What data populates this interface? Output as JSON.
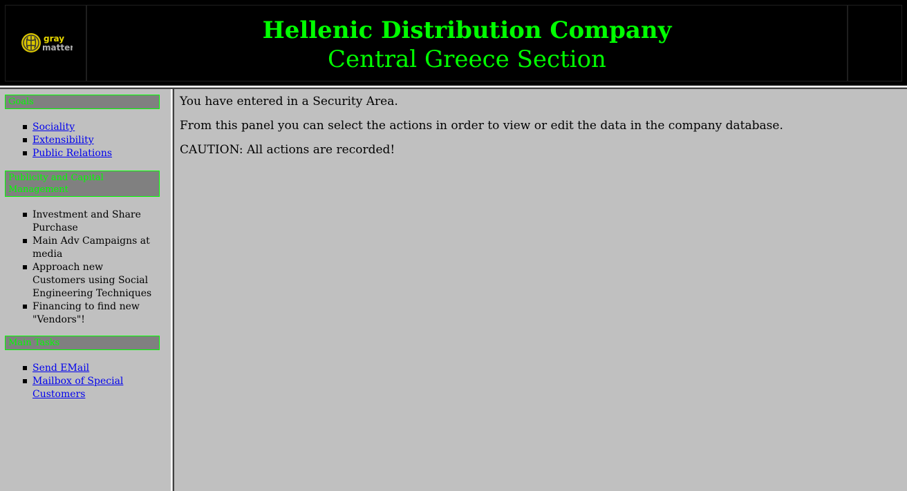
{
  "header": {
    "logo_text_1": "gray",
    "logo_text_2": "matter",
    "title": "Hellenic Distribution Company",
    "subtitle": "Central Greece Section"
  },
  "sidebar": {
    "sections": [
      {
        "heading": "Goals",
        "items": [
          {
            "label": "Sociality",
            "link": true
          },
          {
            "label": "Extensibility",
            "link": true
          },
          {
            "label": "Public Relations",
            "link": true
          }
        ]
      },
      {
        "heading": "Publicity and Capital Management",
        "items": [
          {
            "label": "Investment and Share Purchase",
            "link": false
          },
          {
            "label": "Main Adv Campaigns at media",
            "link": false
          },
          {
            "label": "Approach new Customers using Social Engineering Techniques",
            "link": false
          },
          {
            "label": "Financing to find new \"Vendors\"!",
            "link": false
          }
        ]
      },
      {
        "heading": "Main Tasks",
        "items": [
          {
            "label": "Send EMail",
            "link": true
          },
          {
            "label": "Mailbox of Special Customers",
            "link": true
          }
        ]
      }
    ]
  },
  "content": {
    "line1": "You have entered in a Security Area.",
    "line2": "From this panel you can select the actions in order to view or edit the data in the company database.",
    "line3": "CAUTION: All actions are recorded!"
  },
  "colors": {
    "accent": "#00ff00",
    "header_bg": "#000000",
    "panel_bg": "#c0c0c0",
    "section_bg": "#808080",
    "link": "#0000ee"
  }
}
